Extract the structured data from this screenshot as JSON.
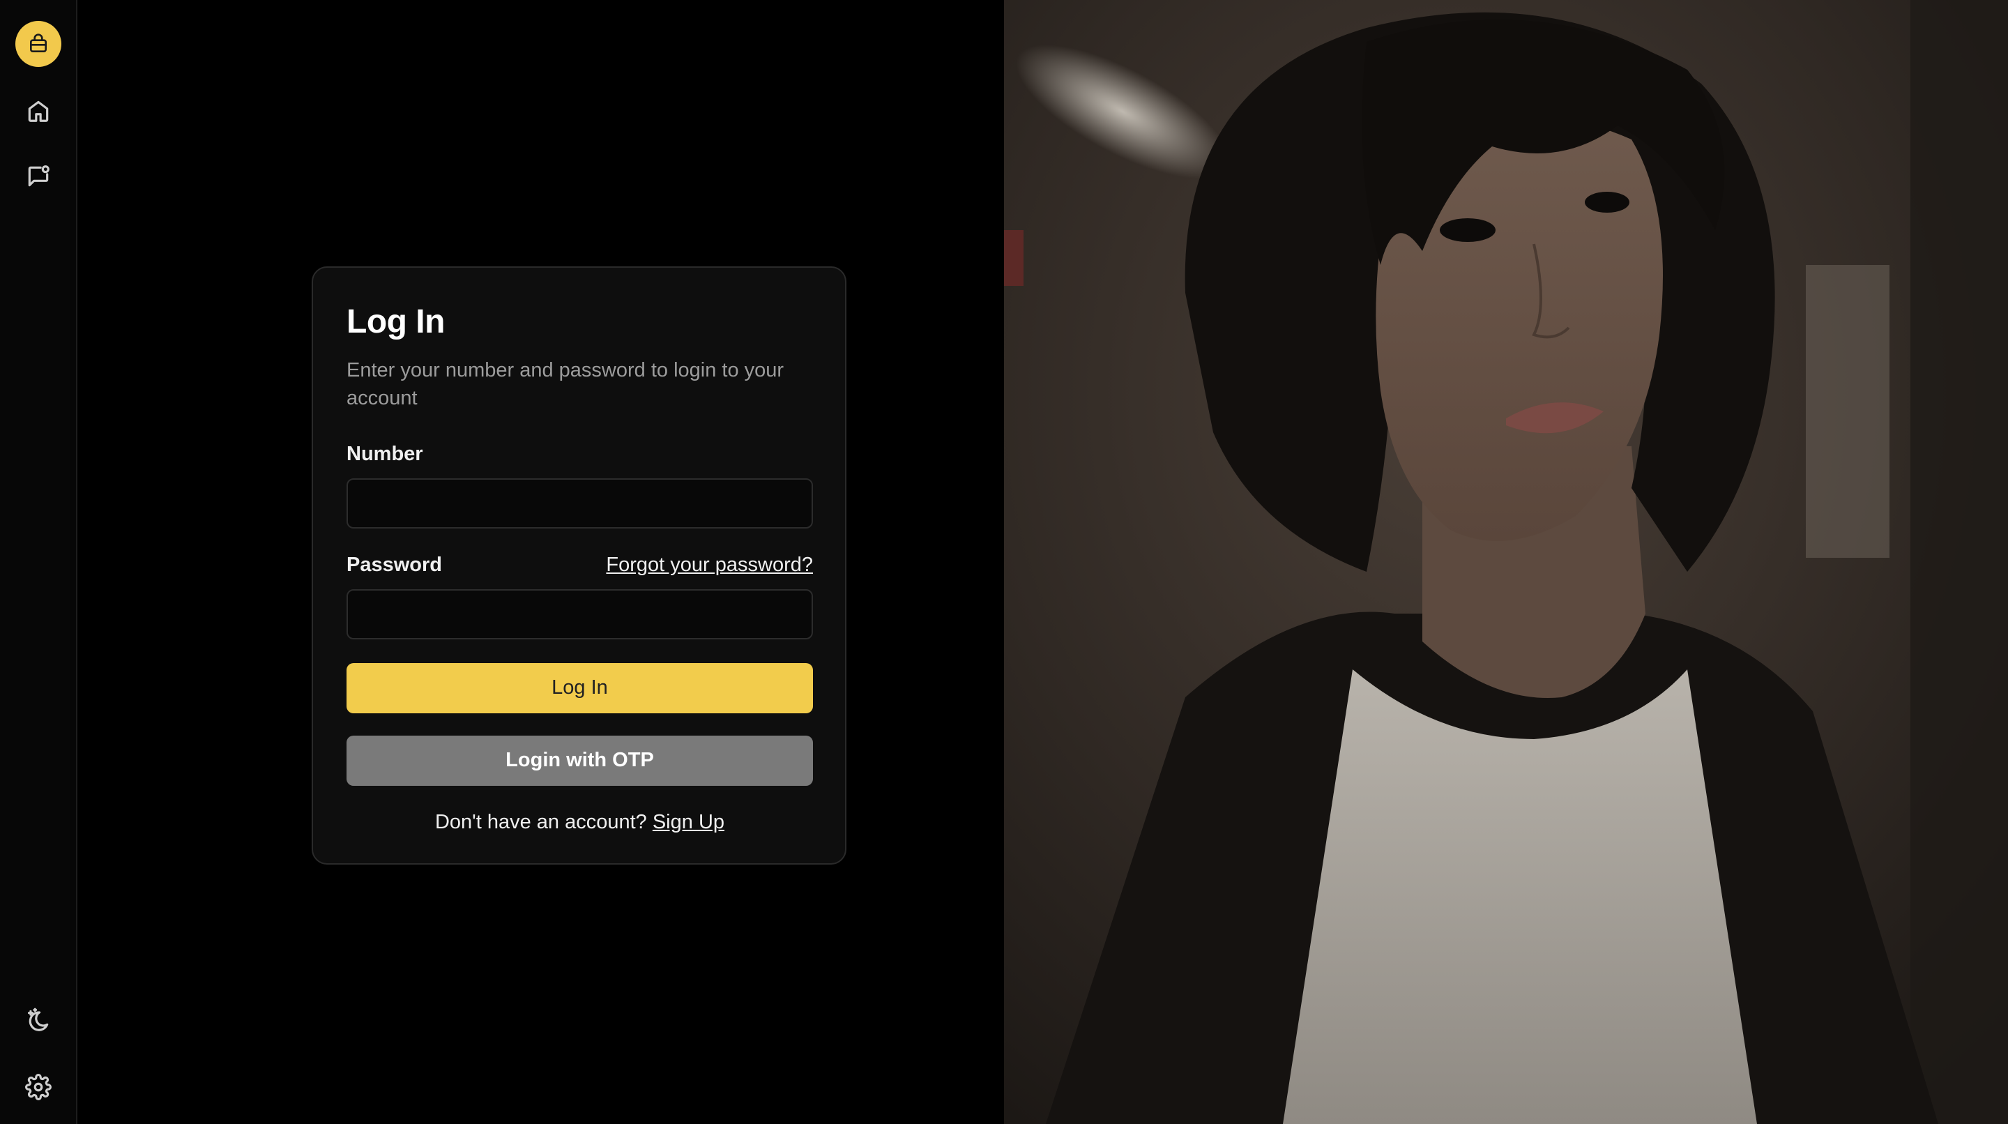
{
  "sidebar": {
    "items": [
      {
        "name": "brand",
        "icon": "shopping-bag-icon"
      },
      {
        "name": "home",
        "icon": "home-icon"
      },
      {
        "name": "messages",
        "icon": "message-notification-icon"
      },
      {
        "name": "theme",
        "icon": "moon-stars-icon"
      },
      {
        "name": "settings",
        "icon": "gear-icon"
      }
    ]
  },
  "login": {
    "title": "Log In",
    "subtitle": "Enter your number and password to login to your account",
    "number_label": "Number",
    "number_value": "",
    "password_label": "Password",
    "password_value": "",
    "forgot_link": "Forgot your password?",
    "login_button": "Log In",
    "otp_button": "Login with OTP",
    "signup_prompt": "Don't have an account?",
    "signup_link": "Sign Up"
  },
  "hero_image": {
    "description_icon": "portrait-photo"
  },
  "colors": {
    "accent": "#f2cc4c",
    "background": "#000000",
    "card": "#0e0e0e",
    "secondary_button": "#7a7a7a"
  }
}
